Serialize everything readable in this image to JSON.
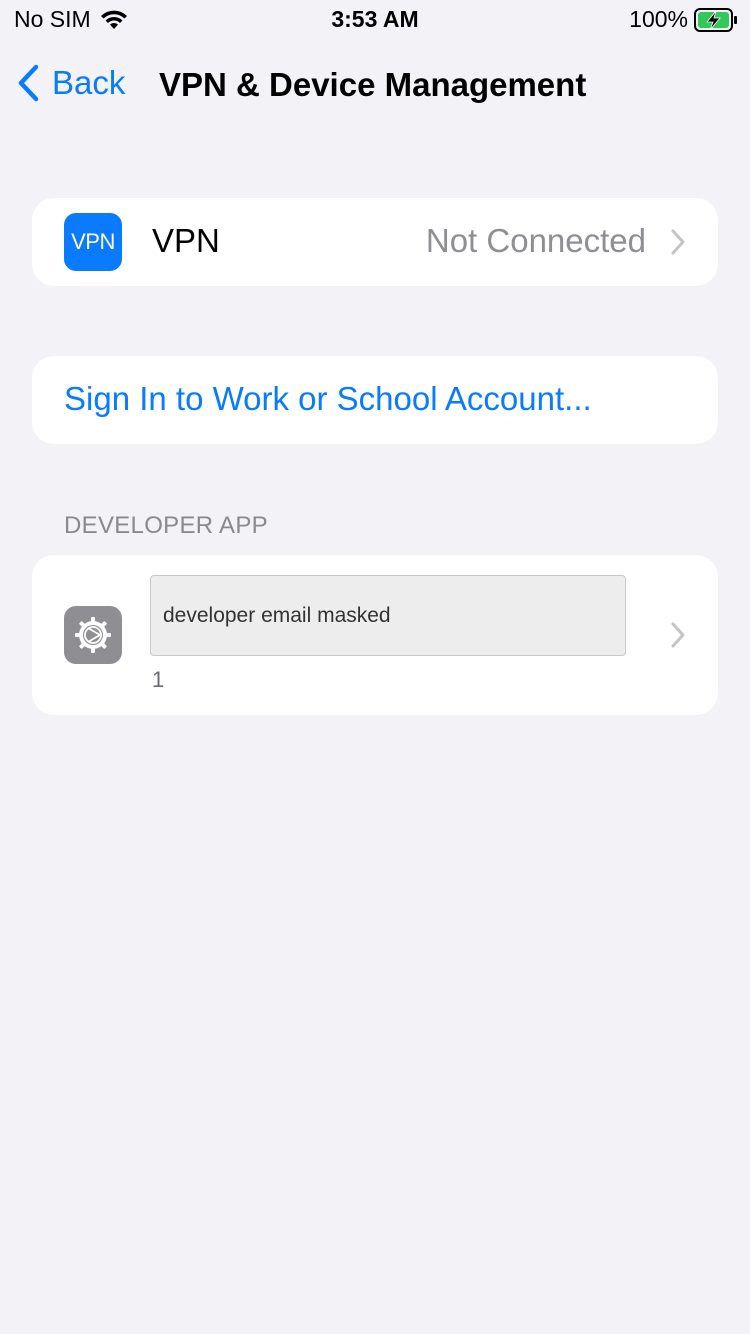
{
  "status_bar": {
    "carrier": "No SIM",
    "time": "3:53 AM",
    "battery_percent": "100%",
    "battery_level": 1.0,
    "charging": true
  },
  "nav": {
    "back_label": "Back",
    "title": "VPN & Device Management"
  },
  "vpn_row": {
    "icon_text": "VPN",
    "label": "VPN",
    "status": "Not Connected"
  },
  "signin_row": {
    "label": "Sign In to Work or School Account..."
  },
  "developer_section": {
    "header": "DEVELOPER APP",
    "masked_label": "developer email masked",
    "count": "1"
  },
  "colors": {
    "accent": "#0a7aff",
    "background": "#f2f2f7",
    "secondary_text": "#8e8e93",
    "battery_green": "#34c759"
  },
  "icons": {
    "wifi": "wifi-icon",
    "battery": "battery-charging-icon",
    "back": "chevron-left-icon",
    "row_disclosure": "chevron-right-icon",
    "developer_app": "settings-gear-icon"
  }
}
